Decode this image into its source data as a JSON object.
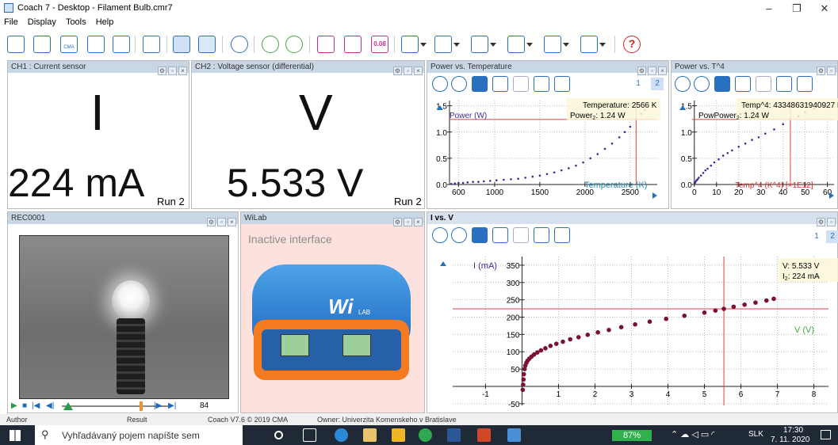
{
  "window": {
    "title": "Coach 7 - Desktop - Filament Bulb.cmr7",
    "minimize": "–",
    "maximize": "❐",
    "close": "✕"
  },
  "menu": [
    "File",
    "Display",
    "Tools",
    "Help"
  ],
  "toolbar": {
    "value_button": "0.08"
  },
  "panels": {
    "ch1": {
      "title": "CH1 : Current sensor",
      "symbol": "I",
      "value": "224 mA",
      "run": "Run 2"
    },
    "ch2": {
      "title": "CH2 : Voltage sensor (differential)",
      "symbol": "V",
      "value": "5.533 V",
      "run": "Run 2"
    },
    "rec": {
      "title": "REC0001",
      "frame": "84"
    },
    "wilab": {
      "title": "WiLab",
      "status": "Inactive interface",
      "brand": "Wi",
      "brand_sub": "LAB"
    },
    "pvt": {
      "title": "Power vs. Temperature",
      "readout1": "Temperature: 2566 K",
      "readout2": "Power",
      "readout2_sub": "2",
      "readout2_val": ": 1.24 W",
      "page1": "1",
      "page2": "2"
    },
    "pvt4": {
      "title": "Power vs. T^4",
      "readout1": "Temp^4: 43348631940927 K^",
      "readout2": "PowPower",
      "readout2_sub": "2",
      "readout2_val": ": 1.24 W"
    },
    "ivv": {
      "title": "I vs. V",
      "readout1": "V: 5.533 V",
      "readout2": "I",
      "readout2_sub": "2",
      "readout2_val": ": 224 mA",
      "page1": "1",
      "page2": "2"
    }
  },
  "chart_data": [
    {
      "type": "scatter",
      "title": "Power vs. Temperature",
      "ylabel": "Power (W)",
      "xlabel": "Temperature (K)",
      "xlim": [
        500,
        2800
      ],
      "ylim": [
        0,
        1.6
      ],
      "xticks": [
        "600",
        "1000",
        "1500",
        "2000",
        "2500"
      ],
      "yticks": [
        "0.0",
        "0.5",
        "1.0",
        "1.5"
      ],
      "grid": true,
      "cursor": {
        "x": 2566,
        "y": 1.24
      },
      "x": [
        520,
        560,
        600,
        650,
        700,
        760,
        820,
        880,
        950,
        1020,
        1100,
        1180,
        1260,
        1340,
        1420,
        1500,
        1580,
        1660,
        1740,
        1820,
        1900,
        1980,
        2060,
        2140,
        2220,
        2300,
        2380,
        2440,
        2500,
        2566,
        2620,
        2660
      ],
      "y": [
        0.01,
        0.02,
        0.03,
        0.03,
        0.04,
        0.05,
        0.05,
        0.06,
        0.07,
        0.08,
        0.09,
        0.1,
        0.11,
        0.13,
        0.15,
        0.17,
        0.2,
        0.23,
        0.27,
        0.31,
        0.36,
        0.42,
        0.5,
        0.58,
        0.68,
        0.78,
        0.9,
        1.0,
        1.1,
        1.24,
        1.35,
        1.42
      ]
    },
    {
      "type": "scatter",
      "title": "Power vs. T^4",
      "ylabel": "Power (W)",
      "xlabel": "Temp^4 (K^4) [×1E12]",
      "xlim": [
        -1,
        63
      ],
      "ylim": [
        0,
        1.6
      ],
      "xticks": [
        "0",
        "10",
        "20",
        "30",
        "40",
        "50",
        "60"
      ],
      "yticks": [
        "0.0",
        "0.5",
        "1.0",
        "1.5"
      ],
      "grid": true,
      "cursor": {
        "x": 43.3,
        "y": 1.24
      },
      "x": [
        0.1,
        0.2,
        0.5,
        1,
        1.5,
        2,
        3,
        4,
        5,
        6,
        7.5,
        9,
        11,
        13,
        15,
        17,
        20,
        23,
        26,
        29,
        32,
        36,
        40,
        43.3,
        47,
        50,
        54,
        58
      ],
      "y": [
        0.02,
        0.03,
        0.05,
        0.08,
        0.1,
        0.13,
        0.17,
        0.22,
        0.27,
        0.3,
        0.36,
        0.42,
        0.48,
        0.55,
        0.6,
        0.65,
        0.72,
        0.78,
        0.85,
        0.9,
        0.97,
        1.05,
        1.15,
        1.24,
        1.3,
        1.38,
        1.45,
        1.5
      ]
    },
    {
      "type": "scatter",
      "title": "I vs. V",
      "ylabel": "I (mA)",
      "xlabel": "V (V)",
      "xlim": [
        -1.9,
        8.4
      ],
      "ylim": [
        -55,
        375
      ],
      "xticks": [
        "-1",
        "1",
        "2",
        "3",
        "4",
        "5",
        "6",
        "7",
        "8"
      ],
      "yticks": [
        "-50",
        "50",
        "100",
        "150",
        "200",
        "250",
        "300",
        "350"
      ],
      "grid": true,
      "cursor": {
        "x": 5.533,
        "y": 224
      },
      "x": [
        0.02,
        0.03,
        0.04,
        0.05,
        0.07,
        0.09,
        0.12,
        0.15,
        0.2,
        0.26,
        0.33,
        0.42,
        0.52,
        0.64,
        0.78,
        0.94,
        1.12,
        1.32,
        1.55,
        1.8,
        2.08,
        2.38,
        2.72,
        3.1,
        3.5,
        3.95,
        4.45,
        5.0,
        5.3,
        5.533,
        5.8,
        6.1,
        6.4,
        6.7,
        6.9
      ],
      "y": [
        -10,
        5,
        20,
        35,
        50,
        60,
        68,
        74,
        80,
        86,
        92,
        98,
        104,
        110,
        117,
        123,
        129,
        136,
        142,
        149,
        156,
        163,
        171,
        179,
        187,
        195,
        204,
        213,
        219,
        224,
        230,
        236,
        242,
        248,
        253
      ]
    }
  ],
  "status": {
    "author": "Author",
    "result": "Result",
    "version": "Coach V7.6 © 2019 CMA",
    "owner": "Owner: Univerzita Komenskeho v Bratislave"
  },
  "taskbar": {
    "search": "Vyhľadávaný pojem napíšte sem",
    "battery": "87%",
    "lang": "SLK",
    "time": "17:30",
    "date": "7. 11. 2020"
  }
}
